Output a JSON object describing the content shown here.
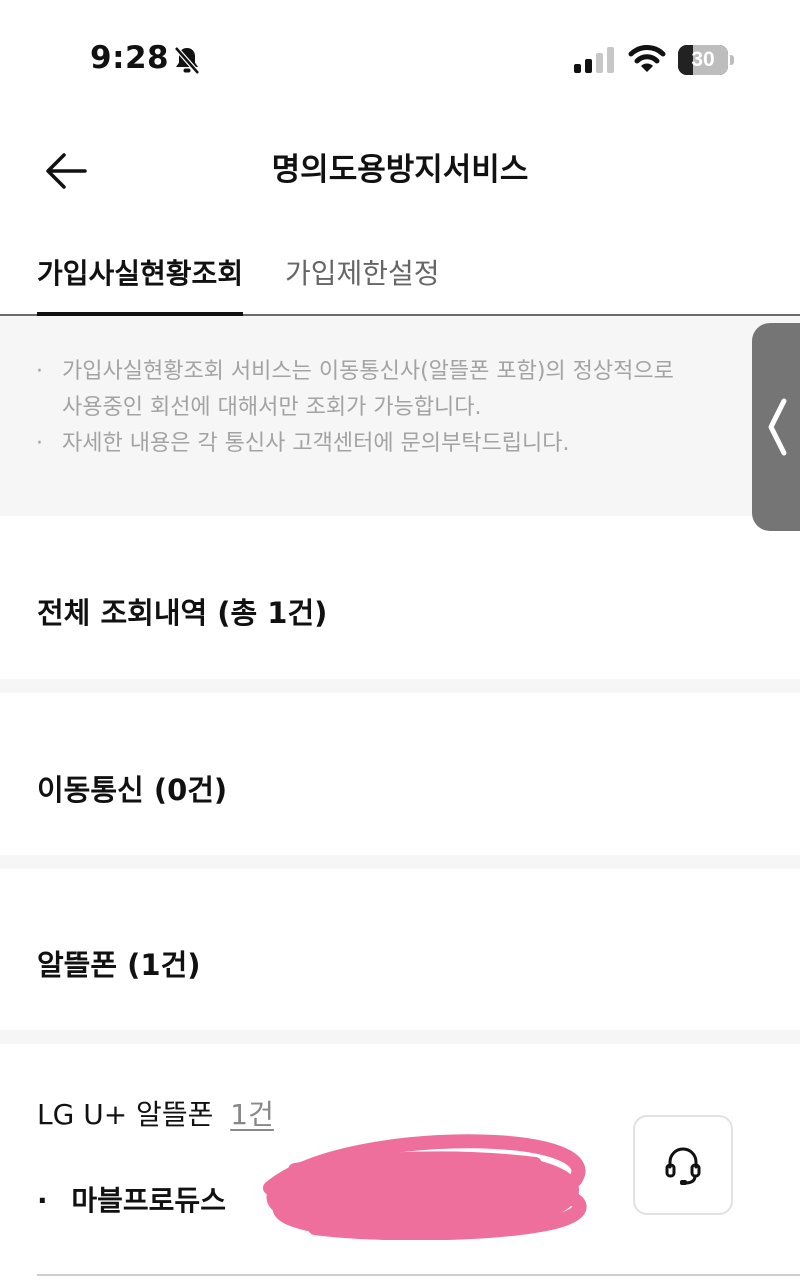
{
  "status_bar": {
    "time": "9:28",
    "icons": [
      "bell-slash-icon",
      "cellular-signal-icon",
      "wifi-icon",
      "battery-icon"
    ],
    "battery_level": "30",
    "battery_fraction": 0.3
  },
  "header": {
    "title": "명의도용방지서비스",
    "back_icon": "arrow-left-icon"
  },
  "tabs": [
    {
      "label": "가입사실현황조회",
      "active": true
    },
    {
      "label": "가입제한설정",
      "active": false
    }
  ],
  "notice": {
    "bullet": "·",
    "items": [
      "가입사실현황조회 서비스는 이동통신사(알뜰폰 포함)의 정상적으로\n사용중인 회선에 대해서만 조회가 가능합니다.",
      "자세한 내용은 각 통신사 고객센터에 문의부탁드립니다."
    ]
  },
  "sections": {
    "total": "전체 조회내역 (총 1건)",
    "mobile": "이동통신 (0건)",
    "mvno": "알뜰폰 (1건)"
  },
  "mvno_detail": {
    "carrier": "LG U+ 알뜰폰",
    "count": "1건",
    "bullet": "·",
    "brand": "마블프로듀스",
    "support_icon": "headset-icon"
  },
  "side_handle": {
    "icon": "chevron-left-icon"
  },
  "colors": {
    "text": "#111111",
    "muted": "#a3a3a3",
    "tab_inactive": "#666666",
    "divider": "#f6f6f6",
    "redaction": "#ee6f9c",
    "handle": "#757575"
  }
}
